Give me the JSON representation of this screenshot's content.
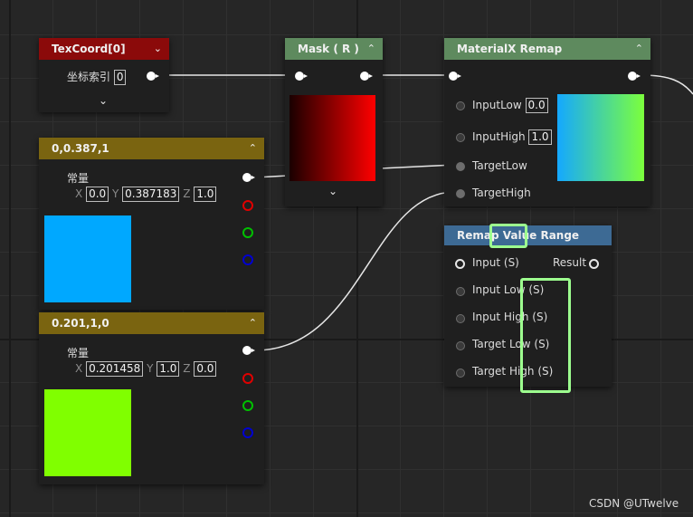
{
  "nodes": {
    "texcoord": {
      "title": "TexCoord[0]",
      "index_label": "坐标索引",
      "index_value": "0"
    },
    "mask": {
      "title": "Mask ( R )"
    },
    "remap": {
      "title": "MaterialX Remap",
      "inputs": [
        "InputLow",
        "InputHigh",
        "TargetLow",
        "TargetHigh"
      ],
      "input_low_value": "0.0",
      "input_high_value": "1.0"
    },
    "const1": {
      "title": "0,0.387,1",
      "label": "常量",
      "x": "0.0",
      "y": "0.387183",
      "z": "1.0",
      "swatch_color": "#00a8ff"
    },
    "const2": {
      "title": "0.201,1,0",
      "label": "常量",
      "x": "0.201458",
      "y": "1.0",
      "z": "0.0",
      "swatch_color": "#80ff00"
    },
    "remap_range": {
      "title": "Remap Value Range",
      "input": "Input (S)",
      "result": "Result",
      "params": [
        "Input Low (S)",
        "Input High (S)",
        "Target Low (S)",
        "Target High (S)"
      ]
    }
  },
  "axis_labels": {
    "x": "X",
    "y": "Y",
    "z": "Z"
  },
  "watermark": "CSDN @UTwelve",
  "icons": {
    "collapse": "chevron-up-icon",
    "expand": "chevron-down-icon"
  },
  "colors": {
    "texcoord_header": "#8b0a0a",
    "mask_header": "#5e8a5e",
    "remap_header": "#5e8a5e",
    "const_header": "#7a6410",
    "range_header": "#3d6a94",
    "highlight": "#9dff8f"
  }
}
